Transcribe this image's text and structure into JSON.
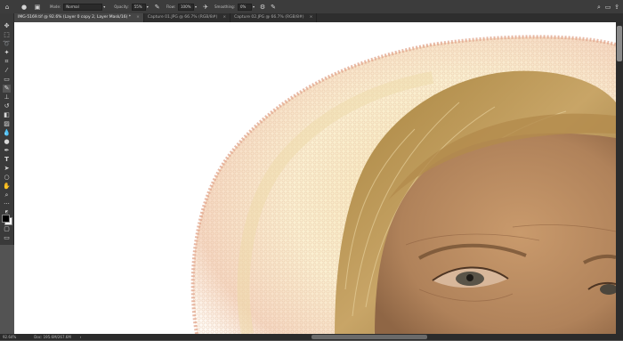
{
  "options": {
    "mode_label": "Mode:",
    "mode_value": "Normal",
    "opacity_label": "Opacity:",
    "opacity_value": "55%",
    "flow_label": "Flow:",
    "flow_value": "100%",
    "smoothing_label": "Smoothing:",
    "smoothing_value": "0%"
  },
  "tabs": [
    {
      "label": "IMG-5169.tif @ 92.6% (Layer 0 copy 2, Layer Mask/16) *"
    },
    {
      "label": "Capture 01.JPG @ 66.7% (RGB/8#)"
    },
    {
      "label": "Capture 02.JPG @ 66.7% (RGB/8#)"
    }
  ],
  "status": {
    "zoom": "92.64%",
    "doc": "Doc: 195.6M/267.6M"
  },
  "colors": {
    "foreground": "#000000",
    "background": "#ffffff",
    "ui_dark": "#3c3c3c"
  }
}
